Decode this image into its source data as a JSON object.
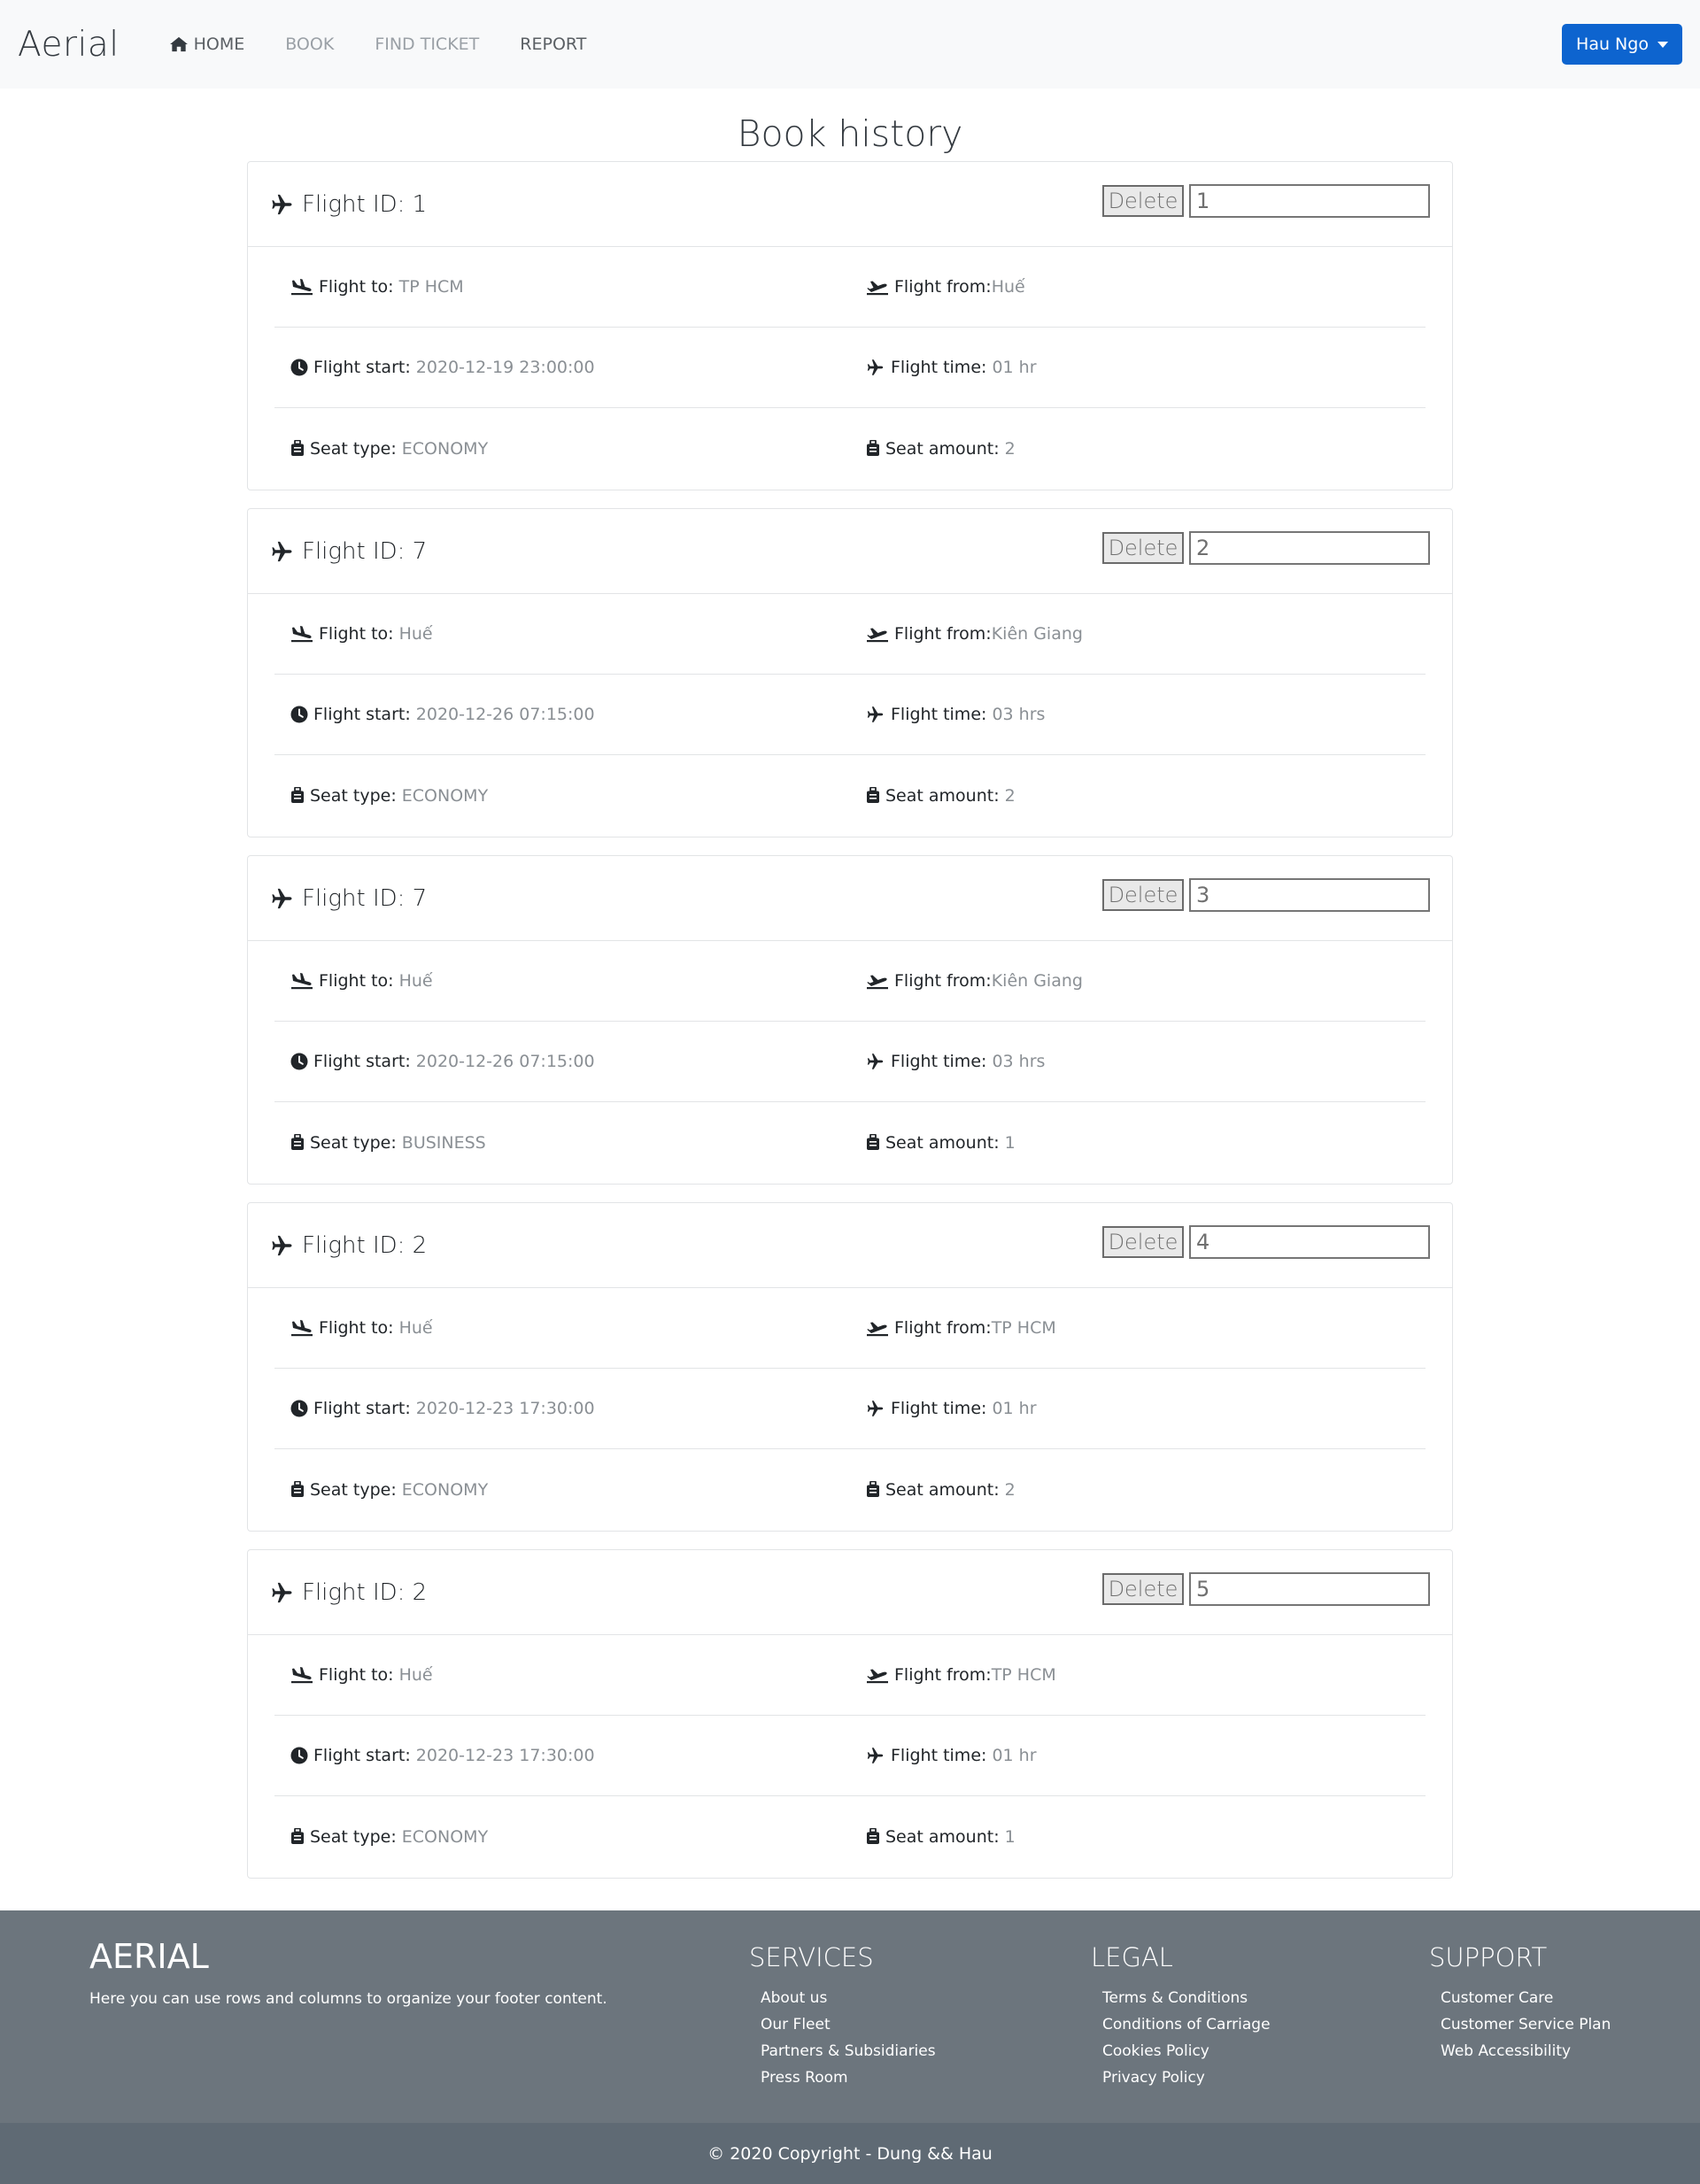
{
  "navbar": {
    "brand": "Aerial",
    "items": [
      {
        "label": "HOME",
        "icon": "home-icon"
      },
      {
        "label": "BOOK"
      },
      {
        "label": "FIND TICKET"
      },
      {
        "label": "REPORT"
      }
    ],
    "user_label": "Hau Ngo"
  },
  "page_title": "Book history",
  "labels": {
    "flight_id": "Flight ID: ",
    "flight_to": "Flight to: ",
    "flight_from": "Flight from:",
    "flight_start": "Flight start: ",
    "flight_time": "Flight time: ",
    "seat_type": "Seat type: ",
    "seat_amount": "Seat amount: ",
    "delete": "Delete"
  },
  "bookings": [
    {
      "flight_id": "1",
      "input_value": "1",
      "to": "TP HCM",
      "from": "Huế",
      "start": "2020-12-19 23:00:00",
      "time": "01 hr",
      "seat_type": "ECONOMY",
      "seat_amount": "2"
    },
    {
      "flight_id": "7",
      "input_value": "2",
      "to": "Huế",
      "from": "Kiên Giang",
      "start": "2020-12-26 07:15:00",
      "time": "03 hrs",
      "seat_type": "ECONOMY",
      "seat_amount": "2"
    },
    {
      "flight_id": "7",
      "input_value": "3",
      "to": "Huế",
      "from": "Kiên Giang",
      "start": "2020-12-26 07:15:00",
      "time": "03 hrs",
      "seat_type": "BUSINESS",
      "seat_amount": "1"
    },
    {
      "flight_id": "2",
      "input_value": "4",
      "to": "Huế",
      "from": "TP HCM",
      "start": "2020-12-23 17:30:00",
      "time": "01 hr",
      "seat_type": "ECONOMY",
      "seat_amount": "2"
    },
    {
      "flight_id": "2",
      "input_value": "5",
      "to": "Huế",
      "from": "TP HCM",
      "start": "2020-12-23 17:30:00",
      "time": "01 hr",
      "seat_type": "ECONOMY",
      "seat_amount": "1"
    }
  ],
  "footer": {
    "brand": "AERIAL",
    "description": "Here you can use rows and columns to organize your footer content.",
    "services": {
      "title": "SERVICES",
      "links": [
        "About us",
        "Our Fleet",
        "Partners & Subsidiaries",
        "Press Room"
      ]
    },
    "legal": {
      "title": "LEGAL",
      "links": [
        "Terms & Conditions",
        "Conditions of Carriage",
        "Cookies Policy",
        "Privacy Policy"
      ]
    },
    "support": {
      "title": "SUPPORT",
      "links": [
        "Customer Care",
        "Customer Service Plan",
        "Web Accessibility"
      ]
    },
    "copyright": "© 2020 Copyright - Dung && Hau"
  }
}
